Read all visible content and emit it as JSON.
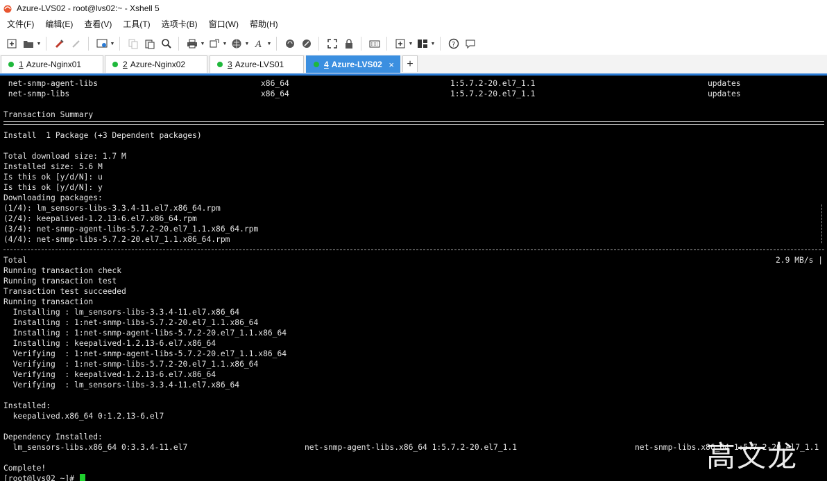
{
  "window": {
    "title": "Azure-LVS02 - root@lvs02:~ - Xshell 5"
  },
  "menu": [
    "文件(F)",
    "编辑(E)",
    "查看(V)",
    "工具(T)",
    "选项卡(B)",
    "窗口(W)",
    "帮助(H)"
  ],
  "toolbar_icons": [
    "new-session-icon",
    "open-folder-icon",
    "reconnect-icon",
    "disconnect-icon",
    "properties-icon",
    "copy-icon",
    "paste-icon",
    "find-icon",
    "print-icon",
    "transfer-icon",
    "globe-icon",
    "font-icon",
    "xftp-icon",
    "xshell-icon",
    "fullscreen-icon",
    "lock-icon",
    "keyboard-icon",
    "new-tab-icon",
    "layout-icon",
    "help-icon",
    "chat-icon"
  ],
  "tabs": [
    {
      "num": "1",
      "label": "Azure-Nginx01"
    },
    {
      "num": "2",
      "label": "Azure-Nginx02"
    },
    {
      "num": "3",
      "label": "Azure-LVS01"
    },
    {
      "num": "4",
      "label": "Azure-LVS02",
      "active": true,
      "close": "×"
    }
  ],
  "tab_add": "+",
  "terminal": {
    "pkg_rows": [
      {
        "name": " net-snmp-agent-libs",
        "arch": "x86_64",
        "version": "1:5.7.2-20.el7_1.1",
        "repo": "updates"
      },
      {
        "name": " net-snmp-libs",
        "arch": "x86_64",
        "version": "1:5.7.2-20.el7_1.1",
        "repo": "updates"
      }
    ],
    "transaction_summary": "Transaction Summary",
    "install_line": "Install  1 Package (+3 Dependent packages)",
    "download_size": "Total download size: 1.7 M",
    "installed_size": "Installed size: 5.6 M",
    "prompt1": "Is this ok [y/d/N]: u",
    "prompt2": "Is this ok [y/d/N]: y",
    "downloading": "Downloading packages:",
    "downloads": [
      "(1/4): lm_sensors-libs-3.3.4-11.el7.x86_64.rpm",
      "(2/4): keepalived-1.2.13-6.el7.x86_64.rpm",
      "(3/4): net-snmp-agent-libs-5.7.2-20.el7_1.1.x86_64.rpm",
      "(4/4): net-snmp-libs-5.7.2-20.el7_1.1.x86_64.rpm"
    ],
    "total": "Total",
    "total_speed": "2.9 MB/s |",
    "steps": [
      "Running transaction check",
      "Running transaction test",
      "Transaction test succeeded",
      "Running transaction",
      "  Installing : lm_sensors-libs-3.3.4-11.el7.x86_64",
      "  Installing : 1:net-snmp-libs-5.7.2-20.el7_1.1.x86_64",
      "  Installing : 1:net-snmp-agent-libs-5.7.2-20.el7_1.1.x86_64",
      "  Installing : keepalived-1.2.13-6.el7.x86_64",
      "  Verifying  : 1:net-snmp-agent-libs-5.7.2-20.el7_1.1.x86_64",
      "  Verifying  : 1:net-snmp-libs-5.7.2-20.el7_1.1.x86_64",
      "  Verifying  : keepalived-1.2.13-6.el7.x86_64",
      "  Verifying  : lm_sensors-libs-3.3.4-11.el7.x86_64"
    ],
    "installed_header": "Installed:",
    "installed_pkg": "  keepalived.x86_64 0:1.2.13-6.el7",
    "dep_header": "Dependency Installed:",
    "deps": [
      "  lm_sensors-libs.x86_64 0:3.3.4-11.el7",
      "net-snmp-agent-libs.x86_64 1:5.7.2-20.el7_1.1",
      "net-snmp-libs.x86_64 1:5.7.2-20.el7_1.1"
    ],
    "complete": "Complete!",
    "prompt": "[root@lvs02 ~]# "
  },
  "watermark": "高文龙",
  "colors": {
    "tab_active": "#3b8fe0",
    "status_dot": "#1fb83b",
    "cursor": "#1fd02e",
    "terminal_bg": "#000000"
  }
}
